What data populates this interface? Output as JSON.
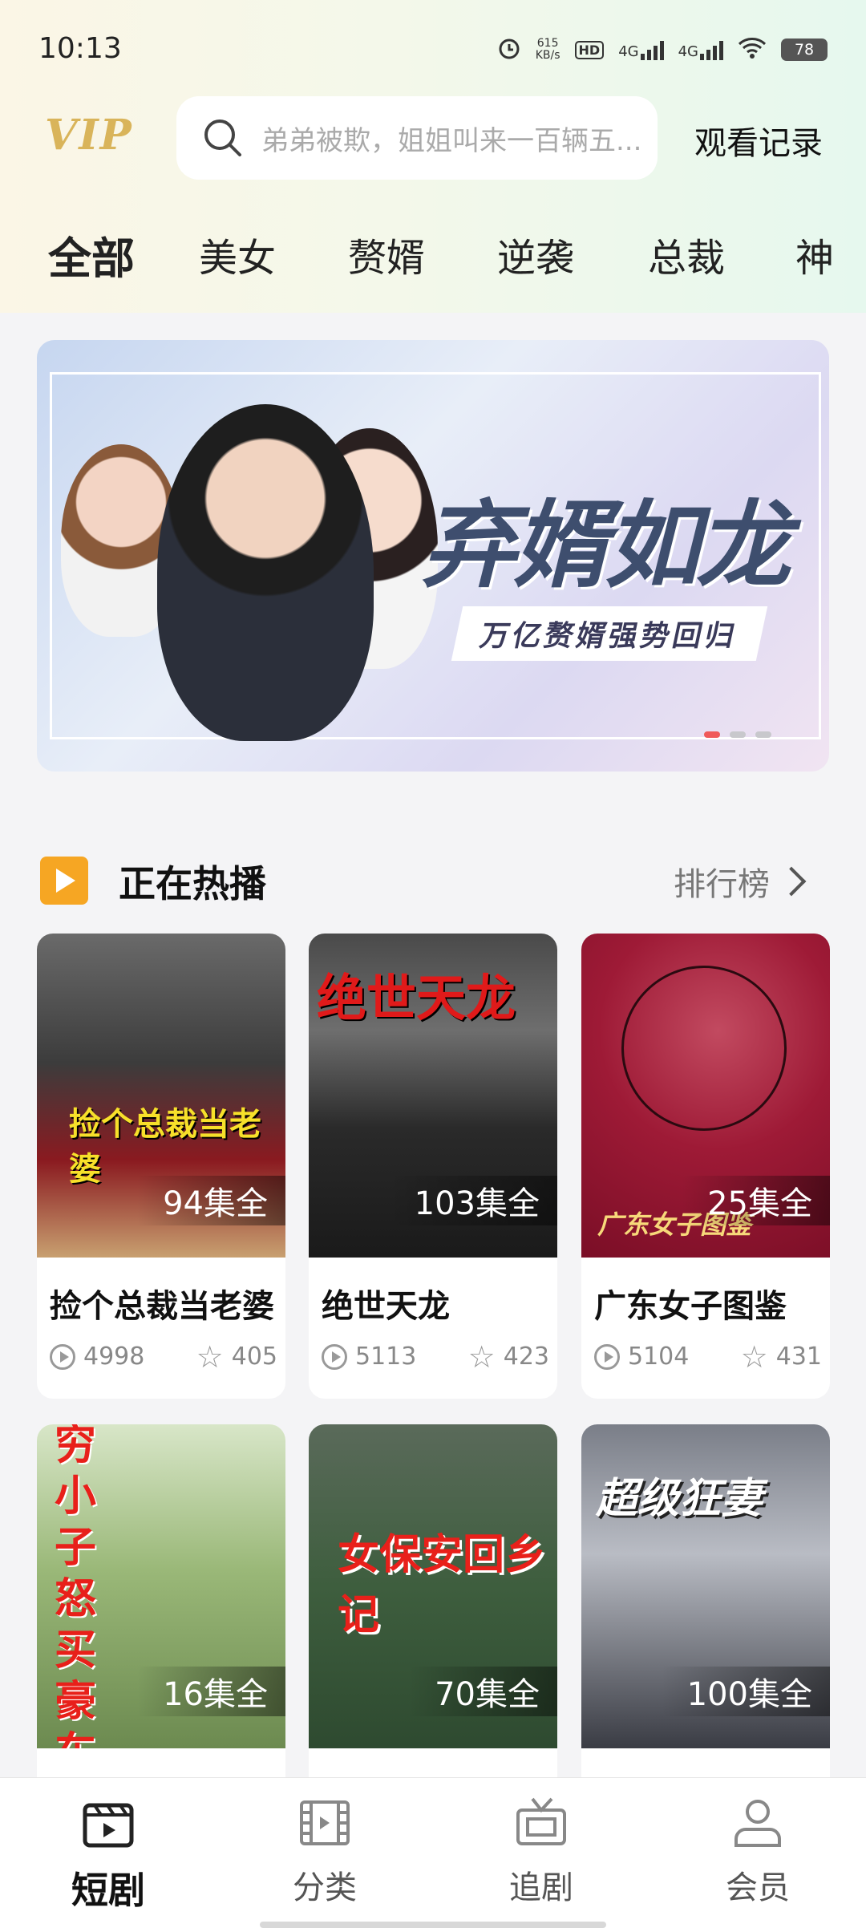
{
  "status_bar": {
    "time": "10:13",
    "net_speed_value": "615",
    "net_speed_unit": "KB/s",
    "hd": "HD",
    "sim1": "4G",
    "sim2": "4G",
    "battery": "78"
  },
  "header": {
    "logo": "VIP",
    "search_placeholder": "弟弟被欺，姐姐叫来一百辆五...",
    "history_label": "观看记录"
  },
  "tabs": [
    "全部",
    "美女",
    "赘婿",
    "逆袭",
    "总裁",
    "神"
  ],
  "banner": {
    "title": "弃婿如龙",
    "subtitle": "万亿赘婿强势回归",
    "active_index": 0,
    "page_count": 3
  },
  "section": {
    "title": "正在热播",
    "more_label": "排行榜"
  },
  "dramas": [
    {
      "title": "捡个总裁当老婆",
      "episodes": "94集全",
      "plays": "4998",
      "favorites": "405",
      "poster_text": "捡个总裁当老婆"
    },
    {
      "title": "绝世天龙",
      "episodes": "103集全",
      "plays": "5113",
      "favorites": "423",
      "poster_text": "绝世天龙"
    },
    {
      "title": "广东女子图鉴",
      "episodes": "25集全",
      "plays": "5104",
      "favorites": "431",
      "poster_text": "广东女子图鉴"
    },
    {
      "title": "",
      "episodes": "16集全",
      "poster_text": "穷小子怒买豪车"
    },
    {
      "title": "",
      "episodes": "70集全",
      "poster_text": "女保安回乡记"
    },
    {
      "title": "",
      "episodes": "100集全",
      "poster_text": "超级狂妻"
    }
  ],
  "bottom_nav": [
    {
      "label": "短剧",
      "icon": "clapperboard-icon",
      "active": true
    },
    {
      "label": "分类",
      "icon": "film-strip-icon",
      "active": false
    },
    {
      "label": "追剧",
      "icon": "tv-icon",
      "active": false
    },
    {
      "label": "会员",
      "icon": "user-icon",
      "active": false
    }
  ],
  "colors": {
    "accent": "#f6a623",
    "vip_gold": "#d9b45a",
    "banner_dot_active": "#f05a5a"
  }
}
